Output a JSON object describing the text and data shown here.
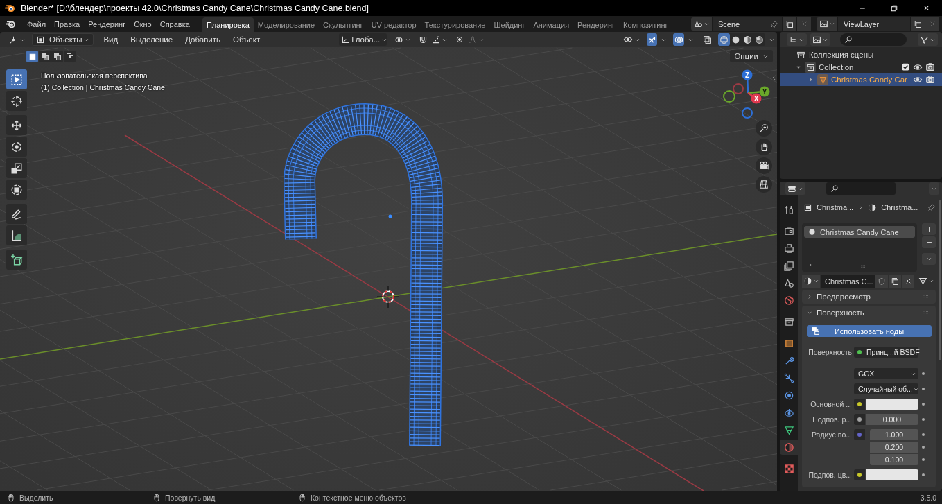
{
  "window": {
    "title": "Blender* [D:\\блендер\\проекты 42.0\\Christmas Candy Cane\\Christmas Candy Cane.blend]"
  },
  "menu": [
    {
      "label": "Файл"
    },
    {
      "label": "Правка"
    },
    {
      "label": "Рендеринг"
    },
    {
      "label": "Окно"
    },
    {
      "label": "Справка"
    }
  ],
  "workspaces": [
    {
      "label": "Планировка",
      "selected": true
    },
    {
      "label": "Моделирование",
      "selected": false
    },
    {
      "label": "Скульптинг",
      "selected": false
    },
    {
      "label": "UV-редактор",
      "selected": false
    },
    {
      "label": "Текстурирование",
      "selected": false
    },
    {
      "label": "Шейдинг",
      "selected": false
    },
    {
      "label": "Анимация",
      "selected": false
    },
    {
      "label": "Рендеринг",
      "selected": false
    },
    {
      "label": "Композитинг",
      "selected": false
    }
  ],
  "scene": {
    "name": "Scene"
  },
  "view_layer": {
    "name": "ViewLayer"
  },
  "viewport": {
    "mode": "Объекты",
    "menus": [
      {
        "label": "Вид"
      },
      {
        "label": "Выделение"
      },
      {
        "label": "Добавить"
      },
      {
        "label": "Объект"
      }
    ],
    "orientation": "Глоба...",
    "snap": {
      "on": false
    },
    "proportional": {
      "on": false
    },
    "gizmos": {
      "on": true
    },
    "overlays": {
      "on": true
    },
    "xray": {
      "on": false
    },
    "shading": [
      {
        "kind": "wireframe",
        "selected": true
      },
      {
        "kind": "solid",
        "selected": false
      },
      {
        "kind": "material",
        "selected": false
      },
      {
        "kind": "rendered",
        "selected": false
      }
    ],
    "select_modes": [
      {
        "kind": "set",
        "selected": true
      },
      {
        "kind": "extend",
        "selected": false
      },
      {
        "kind": "subtract",
        "selected": false
      },
      {
        "kind": "intersect",
        "selected": false
      }
    ],
    "options": "Опции",
    "view_name": "Пользовательская перспектива",
    "object_info": "(1) Collection | Christmas Candy Cane",
    "tool_groups": [
      {
        "tools": [
          {
            "kind": "select",
            "selected": true
          },
          {
            "kind": "cursor",
            "selected": false
          }
        ]
      },
      {
        "tools": [
          {
            "kind": "move",
            "selected": false
          },
          {
            "kind": "rotate",
            "selected": false
          },
          {
            "kind": "scale",
            "selected": false
          },
          {
            "kind": "transform",
            "selected": false
          }
        ]
      },
      {
        "tools": [
          {
            "kind": "annotate",
            "selected": false
          },
          {
            "kind": "measure",
            "selected": false
          }
        ]
      },
      {
        "tools": [
          {
            "kind": "add_cube",
            "selected": false
          }
        ]
      }
    ],
    "axes": [
      {
        "label": "Z"
      },
      {
        "label": "Y"
      },
      {
        "label": "X"
      }
    ]
  },
  "outliner": {
    "items": [
      {
        "label": "Коллекция сцены",
        "kind": "scene_collection",
        "selected": false,
        "children": [
          {
            "label": "Collection",
            "kind": "collection",
            "selected": false,
            "expanded": true,
            "checked": true,
            "children": [
              {
                "label": "Christmas Candy Car",
                "kind": "object",
                "selected": true,
                "expanded": false
              }
            ]
          }
        ]
      }
    ]
  },
  "properties": {
    "tab_groups": [
      {
        "tabs": [
          {
            "kind": "tool",
            "selected": false
          }
        ]
      },
      {
        "tabs": [
          {
            "kind": "render",
            "selected": false
          },
          {
            "kind": "output",
            "selected": false
          },
          {
            "kind": "view_layer",
            "selected": false
          },
          {
            "kind": "scene",
            "selected": false
          },
          {
            "kind": "world",
            "selected": false
          }
        ]
      },
      {
        "tabs": [
          {
            "kind": "collection",
            "selected": false
          }
        ]
      },
      {
        "tabs": [
          {
            "kind": "object",
            "selected": false
          },
          {
            "kind": "modifiers",
            "selected": false
          },
          {
            "kind": "particles",
            "selected": false
          },
          {
            "kind": "physics",
            "selected": false
          },
          {
            "kind": "constraints",
            "selected": false
          },
          {
            "kind": "data",
            "selected": false
          },
          {
            "kind": "material",
            "selected": true
          }
        ]
      },
      {
        "tabs": [
          {
            "kind": "texture",
            "selected": false
          }
        ]
      }
    ],
    "breadcrumb": [
      {
        "label": "Christma...",
        "kind": "object"
      },
      {
        "label": "Christma...",
        "kind": "material"
      }
    ],
    "material_slots": [
      {
        "label": "Christmas Candy Cane",
        "selected": true
      }
    ],
    "material_name": "Christmas C...",
    "panels": [
      {
        "title": "Предпросмотр",
        "expanded": false
      },
      {
        "title": "Поверхность",
        "expanded": true,
        "use_nodes": "Использовать ноды",
        "fields": [
          {
            "kind": "link",
            "label": "Поверхность",
            "color": "#4fbf4f",
            "value": "Принц...й BSDF"
          },
          {
            "kind": "dropdown",
            "value": "GGX"
          },
          {
            "kind": "dropdown",
            "value": "Случайный об..."
          },
          {
            "kind": "color",
            "label": "Основной ...",
            "color": "#c7c729",
            "swatch": {
              "color": "#e6e6e6"
            }
          },
          {
            "kind": "number",
            "label": "Подпов. р...",
            "color": "#a1a1a1",
            "value": "0.000"
          },
          {
            "kind": "vector",
            "label": "Радиус по...",
            "color": "#6363c7",
            "values": [
              "1.000",
              "0.200",
              "0.100"
            ]
          },
          {
            "kind": "color",
            "label": "Подпов. цв...",
            "color": "#c7c729",
            "swatch": {
              "color": "#e6e6e6"
            }
          }
        ]
      }
    ]
  },
  "status_bar": {
    "hints": [
      {
        "label": "Выделить",
        "kind": "left"
      },
      {
        "label": "Повернуть вид",
        "kind": "middle"
      },
      {
        "label": "Контекстное меню объектов",
        "kind": "right"
      }
    ],
    "version": "3.5.0"
  }
}
